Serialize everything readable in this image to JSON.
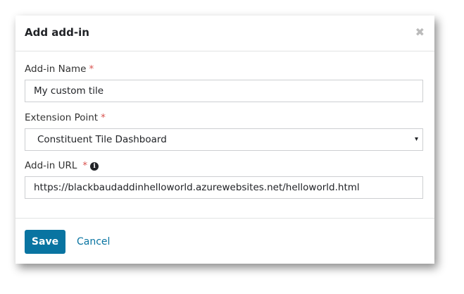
{
  "dialog": {
    "title": "Add add-in",
    "close_icon": "close-icon",
    "fields": {
      "name": {
        "label": "Add-in Name",
        "required": "*",
        "value": "My custom tile"
      },
      "extension_point": {
        "label": "Extension Point",
        "required": "*",
        "value": "Constituent Tile Dashboard",
        "caret": "▾"
      },
      "url": {
        "label": "Add-in URL",
        "required": "*",
        "info_icon": "i",
        "value": "https://blackbaudaddinhelloworld.azurewebsites.net/helloworld.html"
      }
    },
    "footer": {
      "save_label": "Save",
      "cancel_label": "Cancel"
    }
  },
  "colors": {
    "primary": "#0974a1",
    "required": "#d9534f"
  }
}
